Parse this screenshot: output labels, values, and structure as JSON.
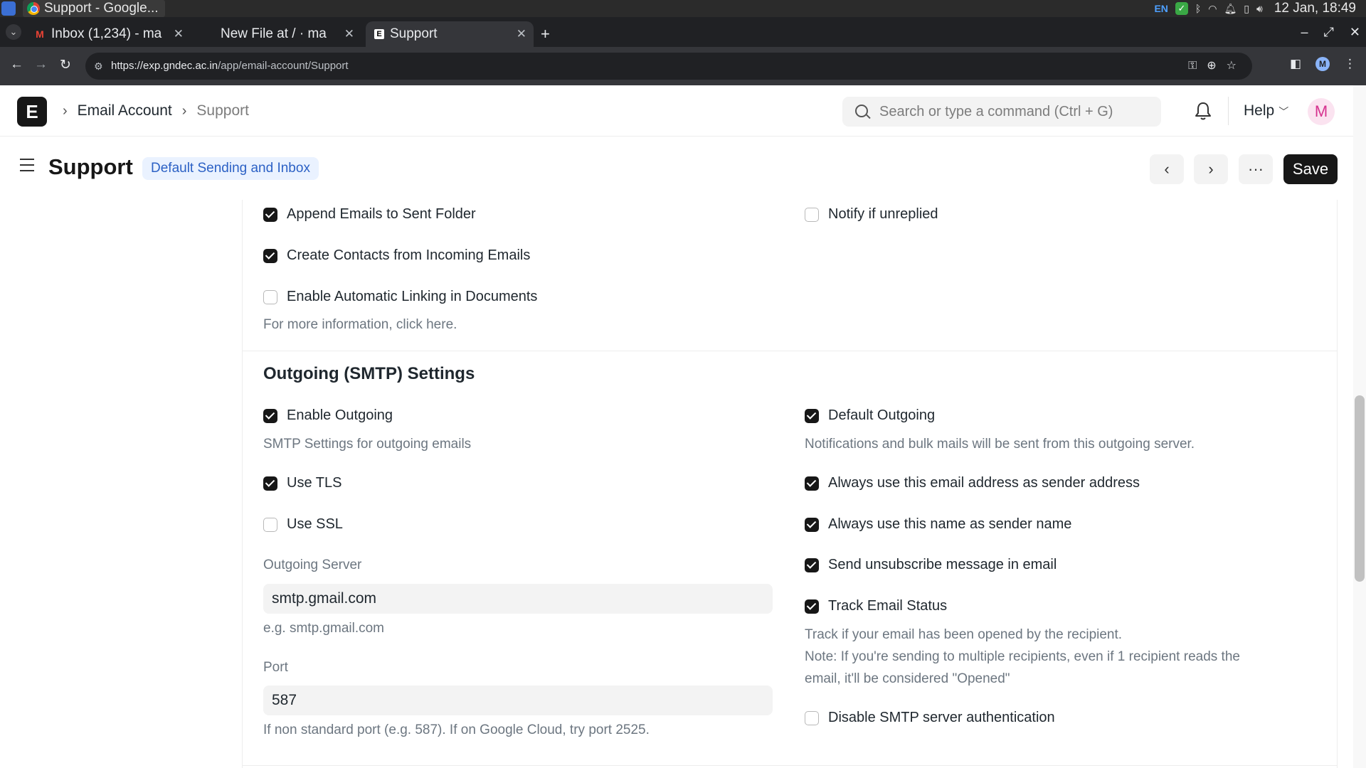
{
  "os": {
    "window_title": "Support - Google...",
    "tray_lang": "EN",
    "clock": "12 Jan, 18:49"
  },
  "browser": {
    "tabs": [
      {
        "label": "Inbox (1,234) - ma",
        "favicon": "M"
      },
      {
        "label": "New File at / · ma",
        "favicon": ""
      },
      {
        "label": "Support",
        "favicon": "E"
      }
    ],
    "url_host": "https://exp.gndec.ac.in",
    "url_path": "/app/email-account/Support",
    "profile_initial": "M"
  },
  "navbar": {
    "logo_letter": "E",
    "breadcrumb": [
      "Email Account",
      "Support"
    ],
    "search_placeholder": "Search or type a command (Ctrl + G)",
    "help_label": "Help",
    "avatar_initial": "M"
  },
  "page": {
    "title": "Support",
    "status": "Default Sending and Inbox",
    "save_label": "Save"
  },
  "incoming": {
    "append_sent": {
      "label": "Append Emails to Sent Folder",
      "checked": true
    },
    "notify_unreplied": {
      "label": "Notify if unreplied",
      "checked": false
    },
    "create_contacts": {
      "label": "Create Contacts from Incoming Emails",
      "checked": true
    },
    "auto_linking": {
      "label": "Enable Automatic Linking in Documents",
      "checked": false
    },
    "auto_linking_desc": "For more information, click here."
  },
  "outgoing": {
    "heading": "Outgoing (SMTP) Settings",
    "enable_outgoing": {
      "label": "Enable Outgoing",
      "checked": true
    },
    "enable_outgoing_desc": "SMTP Settings for outgoing emails",
    "default_outgoing": {
      "label": "Default Outgoing",
      "checked": true
    },
    "default_outgoing_desc": "Notifications and bulk mails will be sent from this outgoing server.",
    "use_tls": {
      "label": "Use TLS",
      "checked": true
    },
    "use_ssl": {
      "label": "Use SSL",
      "checked": false
    },
    "always_sender_address": {
      "label": "Always use this email address as sender address",
      "checked": true
    },
    "always_sender_name": {
      "label": "Always use this name as sender name",
      "checked": true
    },
    "send_unsubscribe": {
      "label": "Send unsubscribe message in email",
      "checked": true
    },
    "track_status": {
      "label": "Track Email Status",
      "checked": true
    },
    "track_status_desc_1": "Track if your email has been opened by the recipient.",
    "track_status_desc_2": "Note: If you're sending to multiple recipients, even if 1 recipient reads the",
    "track_status_desc_3": "email, it'll be considered \"Opened\"",
    "disable_auth": {
      "label": "Disable SMTP server authentication",
      "checked": false
    },
    "server_label": "Outgoing Server",
    "server_value": "smtp.gmail.com",
    "server_desc": "e.g. smtp.gmail.com",
    "port_label": "Port",
    "port_value": "587",
    "port_desc": "If non standard port (e.g. 587). If on Google Cloud, try port 2525."
  }
}
